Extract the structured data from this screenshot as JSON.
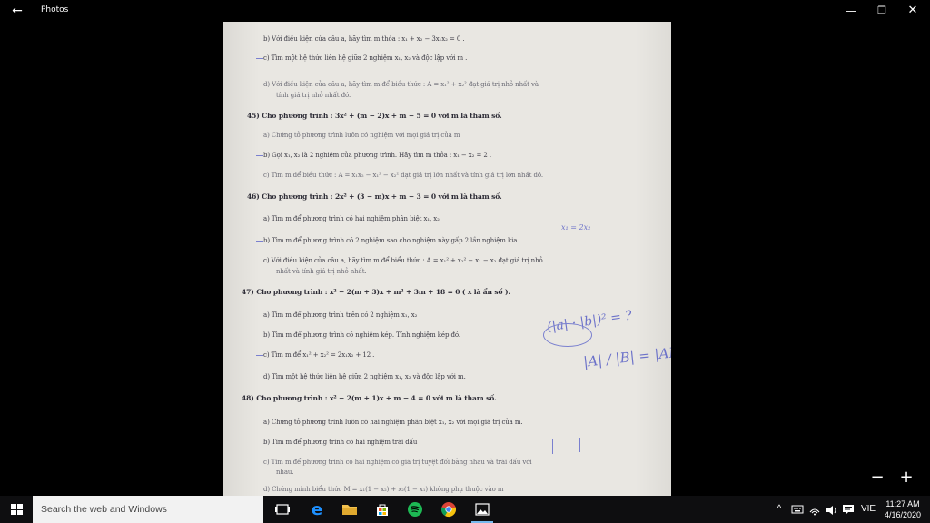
{
  "window": {
    "title": "Photos",
    "back_icon": "arrow-left-icon",
    "controls": {
      "minimize": "—",
      "maximize": "❐",
      "close": "✕"
    }
  },
  "photo": {
    "lines": [
      "b)  Với điều kiện của câu a, hãy tìm m thỏa : x₁ + x₂ − 3x₁x₂ = 0 .",
      "c)  Tìm một hệ thức liên hệ giữa 2 nghiệm x₁, x₂ và độc lập với m .",
      "d)  Với điều kiện của câu a, hãy tìm m để biểu thức : A = x₁² + x₂²  đạt giá trị nhỏ nhất và",
      "tính giá trị nhỏ nhất đó.",
      "45) Cho phương trình : 3x² + (m − 2)x + m − 5 = 0  với m là tham số.",
      "a)  Chứng tỏ phương trình luôn có nghiệm với mọi giá trị của m",
      "b)  Gọi x₁, x₂ là 2 nghiệm của phương trình. Hãy tìm m thỏa : x₁ − x₂ = 2 .",
      "c)  Tìm m để biểu thức : A = x₁x₂ − x₁² − x₂²  đạt giá trị lớn nhất và tính giá trị lớn nhất đó.",
      "46) Cho phương trình : 2x² + (3 − m)x + m − 3 = 0   với m là tham số.",
      "a)  Tìm m để phương trình có hai nghiệm phân biệt x₁, x₂",
      "b)  Tìm m để phương trình có 2 nghiệm sao cho nghiệm này gấp 2 lần nghiệm kia.",
      "c)  Với điều kiện của câu a, hãy tìm m để biểu thức : A = x₁² + x₂² − x₁ − x₂  đạt giá trị nhỏ",
      "nhất và tính giá trị nhỏ nhất.",
      "47) Cho phương trình : x² − 2(m + 3)x + m² + 3m + 18 = 0  ( x là ẩn số ).",
      "a)  Tìm m để phương trình trên có 2 nghiệm x₁, x₂",
      "b)  Tìm m để phương trình có nghiệm kép. Tính nghiệm kép đó.",
      "c)  Tìm m để  x₁² + x₂² = 2x₁x₂ + 12 .",
      "d)  Tìm một hệ thức liên hệ giữa 2 nghiệm x₁, x₂ và độc lập với m.",
      "48) Cho phương trình : x² − 2(m + 1)x + m − 4 = 0  với m là tham số.",
      "a)  Chứng tỏ phương trình luôn có hai nghiệm phân biệt x₁, x₂ với mọi giá trị của m.",
      "b)  Tìm m để phương trình có hai nghiệm trái dấu",
      "c)  Tìm m để phương trình có hai nghiệm có giá trị tuyệt đối bằng nhau và trái dấu với",
      "nhau.",
      "d)  Chứng minh biểu thức   M = x₁(1 − x₂) + x₂(1 − x₁)  không phụ thuộc vào m"
    ],
    "annotations": {
      "ratio": "x₁ = 2x₂",
      "abs_product": "(|a| · |b|)² = ?",
      "abs_rel": "|A| / |B| = |AB|"
    }
  },
  "zoom": {
    "out": "−",
    "in": "+"
  },
  "taskbar": {
    "search_placeholder": "Search the web and Windows",
    "apps": [
      {
        "name": "task-view",
        "icon": "task-view-icon"
      },
      {
        "name": "edge",
        "icon": "edge-icon"
      },
      {
        "name": "file-explorer",
        "icon": "folder-icon"
      },
      {
        "name": "store",
        "icon": "store-icon"
      },
      {
        "name": "spotify",
        "icon": "spotify-icon"
      },
      {
        "name": "chrome",
        "icon": "chrome-icon"
      },
      {
        "name": "photos",
        "icon": "photos-icon"
      }
    ],
    "tray": {
      "chevron": "^",
      "lang": "VIE",
      "time": "11:27 AM",
      "date": "4/16/2020"
    },
    "colors": {
      "accent": "#76b9ed",
      "spotify": "#1db954",
      "edge": "#1e90ff",
      "folder": "#f2c14e"
    }
  }
}
